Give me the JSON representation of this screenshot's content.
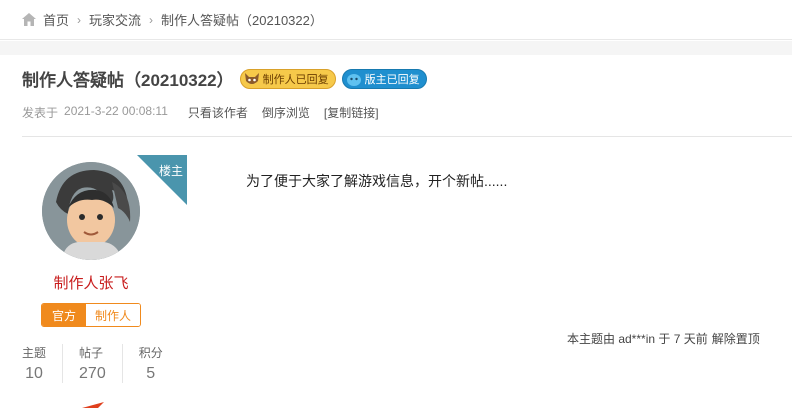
{
  "breadcrumb": {
    "home": "首页",
    "forum": "玩家交流",
    "thread": "制作人答疑帖（20210322）"
  },
  "thread": {
    "title": "制作人答疑帖（20210322）",
    "badge_maker": "制作人已回复",
    "badge_mod": "版主已回复"
  },
  "meta": {
    "posted_label": "发表于",
    "posted_time": "2021-3-22 00:08:11",
    "only_author": "只看该作者",
    "reverse_order": "倒序浏览",
    "copy_link": "[复制链接]"
  },
  "author": {
    "name": "制作人张飞",
    "tag_official": "官方",
    "tag_maker": "制作人",
    "stats": [
      {
        "label": "主题",
        "value": "10"
      },
      {
        "label": "帖子",
        "value": "270"
      },
      {
        "label": "积分",
        "value": "5"
      }
    ]
  },
  "post": {
    "floor_tag": "楼主",
    "content": "为了便于大家了解游戏信息，开个新帖......",
    "pin_text": "本主题由 ad***in 于 7 天前",
    "unpin": "解除置顶"
  },
  "colors": {
    "author_name": "#c81d1d",
    "tag_orange": "#f08a1d",
    "floor_tag": "#4a95ad",
    "badge_mod": "#1f8fcf"
  }
}
